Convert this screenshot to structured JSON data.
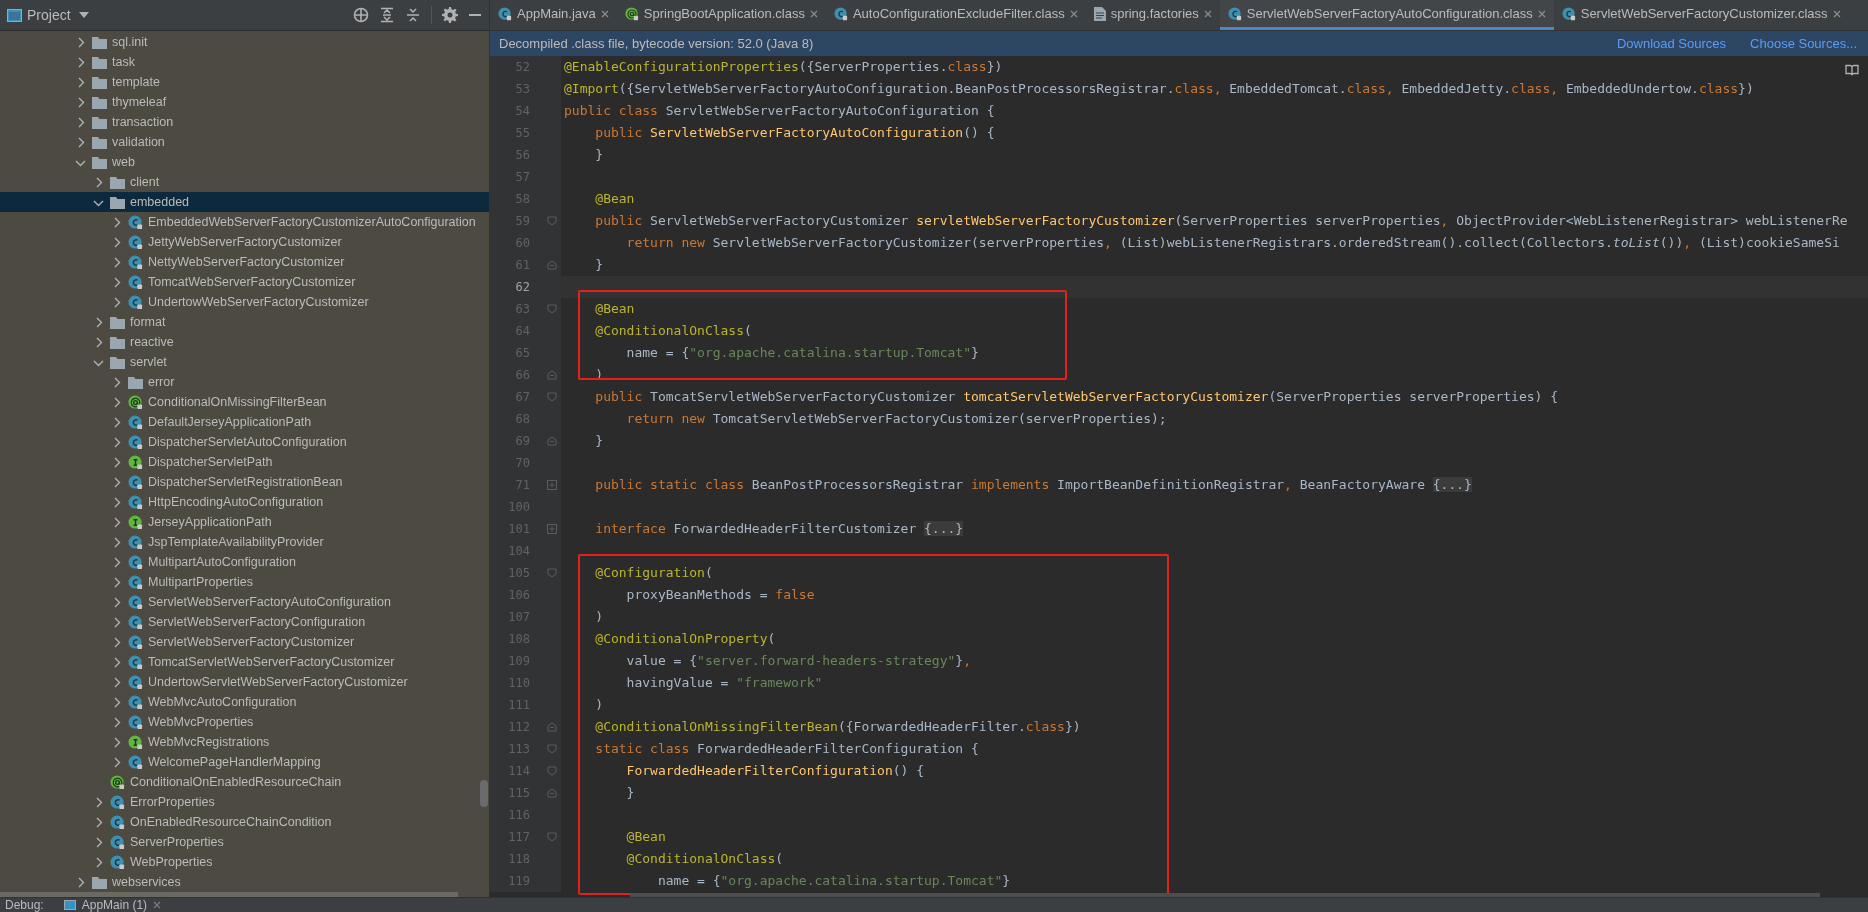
{
  "project_panel": {
    "title": "Project",
    "tree": [
      {
        "label": "sql.init",
        "kind": "folder",
        "expandable": true,
        "expanded": false,
        "selected": false
      },
      {
        "label": "task",
        "kind": "folder",
        "expandable": true,
        "expanded": false,
        "selected": false
      },
      {
        "label": "template",
        "kind": "folder",
        "expandable": true,
        "expanded": false,
        "selected": false
      },
      {
        "label": "thymeleaf",
        "kind": "folder",
        "expandable": true,
        "expanded": false,
        "selected": false
      },
      {
        "label": "transaction",
        "kind": "folder",
        "expandable": true,
        "expanded": false,
        "selected": false
      },
      {
        "label": "validation",
        "kind": "folder",
        "expandable": true,
        "expanded": false,
        "selected": false
      },
      {
        "label": "web",
        "kind": "folder",
        "expandable": true,
        "expanded": true,
        "selected": false,
        "children": [
          {
            "label": "client",
            "kind": "folder",
            "expandable": true,
            "expanded": false,
            "selected": false
          },
          {
            "label": "embedded",
            "kind": "folder",
            "expandable": true,
            "expanded": true,
            "selected": true,
            "children": [
              {
                "label": "EmbeddedWebServerFactoryCustomizerAutoConfiguration",
                "kind": "class",
                "expandable": true,
                "expanded": false,
                "selected": false
              },
              {
                "label": "JettyWebServerFactoryCustomizer",
                "kind": "class",
                "expandable": true,
                "expanded": false,
                "selected": false
              },
              {
                "label": "NettyWebServerFactoryCustomizer",
                "kind": "class",
                "expandable": true,
                "expanded": false,
                "selected": false
              },
              {
                "label": "TomcatWebServerFactoryCustomizer",
                "kind": "class",
                "expandable": true,
                "expanded": false,
                "selected": false
              },
              {
                "label": "UndertowWebServerFactoryCustomizer",
                "kind": "class",
                "expandable": true,
                "expanded": false,
                "selected": false
              }
            ]
          },
          {
            "label": "format",
            "kind": "folder",
            "expandable": true,
            "expanded": false,
            "selected": false
          },
          {
            "label": "reactive",
            "kind": "folder",
            "expandable": true,
            "expanded": false,
            "selected": false
          },
          {
            "label": "servlet",
            "kind": "folder",
            "expandable": true,
            "expanded": true,
            "selected": false,
            "children": [
              {
                "label": "error",
                "kind": "folder",
                "expandable": true,
                "expanded": false,
                "selected": false
              },
              {
                "label": "ConditionalOnMissingFilterBean",
                "kind": "annotation",
                "expandable": true,
                "expanded": false,
                "selected": false
              },
              {
                "label": "DefaultJerseyApplicationPath",
                "kind": "class",
                "expandable": true,
                "expanded": false,
                "selected": false
              },
              {
                "label": "DispatcherServletAutoConfiguration",
                "kind": "class",
                "expandable": true,
                "expanded": false,
                "selected": false
              },
              {
                "label": "DispatcherServletPath",
                "kind": "interface",
                "expandable": true,
                "expanded": false,
                "selected": false
              },
              {
                "label": "DispatcherServletRegistrationBean",
                "kind": "class",
                "expandable": true,
                "expanded": false,
                "selected": false
              },
              {
                "label": "HttpEncodingAutoConfiguration",
                "kind": "class",
                "expandable": true,
                "expanded": false,
                "selected": false
              },
              {
                "label": "JerseyApplicationPath",
                "kind": "interface",
                "expandable": true,
                "expanded": false,
                "selected": false
              },
              {
                "label": "JspTemplateAvailabilityProvider",
                "kind": "class",
                "expandable": true,
                "expanded": false,
                "selected": false
              },
              {
                "label": "MultipartAutoConfiguration",
                "kind": "class",
                "expandable": true,
                "expanded": false,
                "selected": false
              },
              {
                "label": "MultipartProperties",
                "kind": "class",
                "expandable": true,
                "expanded": false,
                "selected": false
              },
              {
                "label": "ServletWebServerFactoryAutoConfiguration",
                "kind": "class",
                "expandable": true,
                "expanded": false,
                "selected": false
              },
              {
                "label": "ServletWebServerFactoryConfiguration",
                "kind": "class",
                "expandable": true,
                "expanded": false,
                "selected": false
              },
              {
                "label": "ServletWebServerFactoryCustomizer",
                "kind": "class",
                "expandable": true,
                "expanded": false,
                "selected": false
              },
              {
                "label": "TomcatServletWebServerFactoryCustomizer",
                "kind": "class",
                "expandable": true,
                "expanded": false,
                "selected": false
              },
              {
                "label": "UndertowServletWebServerFactoryCustomizer",
                "kind": "class",
                "expandable": true,
                "expanded": false,
                "selected": false
              },
              {
                "label": "WebMvcAutoConfiguration",
                "kind": "class",
                "expandable": true,
                "expanded": false,
                "selected": false
              },
              {
                "label": "WebMvcProperties",
                "kind": "class",
                "expandable": true,
                "expanded": false,
                "selected": false
              },
              {
                "label": "WebMvcRegistrations",
                "kind": "interface",
                "expandable": true,
                "expanded": false,
                "selected": false
              },
              {
                "label": "WelcomePageHandlerMapping",
                "kind": "class",
                "expandable": true,
                "expanded": false,
                "selected": false
              }
            ]
          },
          {
            "label": "ConditionalOnEnabledResourceChain",
            "kind": "annotation",
            "expandable": false,
            "selected": false
          },
          {
            "label": "ErrorProperties",
            "kind": "class",
            "expandable": true,
            "expanded": false,
            "selected": false
          },
          {
            "label": "OnEnabledResourceChainCondition",
            "kind": "class",
            "expandable": true,
            "expanded": false,
            "selected": false
          },
          {
            "label": "ServerProperties",
            "kind": "class",
            "expandable": true,
            "expanded": false,
            "selected": false
          },
          {
            "label": "WebProperties",
            "kind": "class",
            "expandable": true,
            "expanded": false,
            "selected": false
          }
        ]
      },
      {
        "label": "webservices",
        "kind": "folder",
        "expandable": true,
        "expanded": false,
        "selected": false
      }
    ]
  },
  "tabs": [
    {
      "label": "AppMain.java",
      "kind": "class",
      "selected": false
    },
    {
      "label": "SpringBootApplication.class",
      "kind": "annotation",
      "selected": false
    },
    {
      "label": "AutoConfigurationExcludeFilter.class",
      "kind": "class",
      "selected": false
    },
    {
      "label": "spring.factories",
      "kind": "file",
      "selected": false
    },
    {
      "label": "ServletWebServerFactoryAutoConfiguration.class",
      "kind": "class",
      "selected": true
    },
    {
      "label": "ServletWebServerFactoryCustomizer.class",
      "kind": "class",
      "selected": false
    }
  ],
  "banner": {
    "message": "Decompiled .class file, bytecode version: 52.0 (Java 8)",
    "links": [
      "Download Sources",
      "Choose Sources..."
    ]
  },
  "code": {
    "blocks": [
      {
        "highlighted": false,
        "lines": [
          {
            "number": "52",
            "current": false,
            "tokens": [
              {
                "kind": "ann",
                "text": "@EnableConfigurationProperties"
              },
              {
                "kind": "plain",
                "text": "({ServerProperties."
              },
              {
                "kind": "kw",
                "text": "class"
              },
              {
                "kind": "plain",
                "text": "})"
              }
            ]
          },
          {
            "number": "53",
            "current": false,
            "tokens": [
              {
                "kind": "ann",
                "text": "@Import"
              },
              {
                "kind": "plain",
                "text": "({ServletWebServerFactoryAutoConfiguration.BeanPostProcessorsRegistrar."
              },
              {
                "kind": "kw",
                "text": "class, "
              },
              {
                "kind": "plain",
                "text": "EmbeddedTomcat."
              },
              {
                "kind": "kw",
                "text": "class, "
              },
              {
                "kind": "plain",
                "text": "EmbeddedJetty."
              },
              {
                "kind": "kw",
                "text": "class, "
              },
              {
                "kind": "plain",
                "text": "EmbeddedUndertow."
              },
              {
                "kind": "kw",
                "text": "class"
              },
              {
                "kind": "plain",
                "text": "})"
              }
            ]
          },
          {
            "number": "54",
            "current": false,
            "tokens": [
              {
                "kind": "kw",
                "text": "public class "
              },
              {
                "kind": "plain",
                "text": "ServletWebServerFactoryAutoConfiguration {"
              }
            ]
          },
          {
            "number": "55",
            "current": false,
            "tokens": [
              {
                "kind": "kw",
                "text": "    public "
              },
              {
                "kind": "fn",
                "text": "ServletWebServerFactoryAutoConfiguration"
              },
              {
                "kind": "plain",
                "text": "() {"
              }
            ]
          },
          {
            "number": "56",
            "current": false,
            "tokens": [
              {
                "kind": "plain",
                "text": "    }"
              }
            ]
          },
          {
            "number": "57",
            "current": false
          },
          {
            "number": "58",
            "current": false,
            "tokens": [
              {
                "kind": "ann",
                "text": "    @Bean"
              }
            ]
          },
          {
            "number": "59",
            "current": false,
            "kind": "fold-start",
            "tokens": [
              {
                "kind": "kw",
                "text": "    public "
              },
              {
                "kind": "plain",
                "text": "ServletWebServerFactoryCustomizer "
              },
              {
                "kind": "fn",
                "text": "servletWebServerFactoryCustomizer"
              },
              {
                "kind": "plain",
                "text": "(ServerProperties serverProperties"
              },
              {
                "kind": "kw",
                "text": ", "
              },
              {
                "kind": "plain",
                "text": "ObjectProvider<WebListenerRegistrar> webListenerRe"
              }
            ]
          },
          {
            "number": "60",
            "current": false,
            "tokens": [
              {
                "kind": "kw",
                "text": "        return new "
              },
              {
                "kind": "plain",
                "text": "ServletWebServerFactoryCustomizer(serverProperties"
              },
              {
                "kind": "kw",
                "text": ", "
              },
              {
                "kind": "plain",
                "text": "(List)webListenerRegistrars.orderedStream().collect(Collectors."
              },
              {
                "kind": "static",
                "text": "toList"
              },
              {
                "kind": "plain",
                "text": "())"
              },
              {
                "kind": "kw",
                "text": ", "
              },
              {
                "kind": "plain",
                "text": "(List)cookieSameSi"
              }
            ]
          },
          {
            "number": "61",
            "current": false,
            "kind": "fold-end",
            "tokens": [
              {
                "kind": "plain",
                "text": "    }"
              }
            ]
          },
          {
            "number": "62",
            "current": true
          }
        ]
      },
      {
        "highlighted": true,
        "lines": [
          {
            "number": "63",
            "current": false,
            "kind": "fold-start",
            "tokens": [
              {
                "kind": "ann",
                "text": "    @Bean"
              }
            ]
          },
          {
            "number": "64",
            "current": false,
            "tokens": [
              {
                "kind": "ann",
                "text": "    @ConditionalOnClass"
              },
              {
                "kind": "plain",
                "text": "("
              }
            ]
          },
          {
            "number": "65",
            "current": false,
            "tokens": [
              {
                "kind": "plain",
                "text": "        name = {"
              },
              {
                "kind": "str",
                "text": "\"org.apache.catalina.startup.Tomcat\""
              },
              {
                "kind": "plain",
                "text": "}"
              }
            ]
          },
          {
            "number": "66",
            "current": false,
            "kind": "fold-end",
            "tokens": [
              {
                "kind": "plain",
                "text": "    )"
              }
            ]
          }
        ]
      },
      {
        "highlighted": false,
        "lines": [
          {
            "number": "67",
            "current": false,
            "kind": "fold-start",
            "tokens": [
              {
                "kind": "kw",
                "text": "    public "
              },
              {
                "kind": "plain",
                "text": "TomcatServletWebServerFactoryCustomizer "
              },
              {
                "kind": "fn",
                "text": "tomcatServletWebServerFactoryCustomizer"
              },
              {
                "kind": "plain",
                "text": "(ServerProperties serverProperties) {"
              }
            ]
          },
          {
            "number": "68",
            "current": false,
            "tokens": [
              {
                "kind": "kw",
                "text": "        return new "
              },
              {
                "kind": "plain",
                "text": "TomcatServletWebServerFactoryCustomizer(serverProperties);"
              }
            ]
          },
          {
            "number": "69",
            "current": false,
            "kind": "fold-end",
            "tokens": [
              {
                "kind": "plain",
                "text": "    }"
              }
            ]
          },
          {
            "number": "70",
            "current": false
          },
          {
            "number": "71",
            "current": false,
            "kind": "collapsed-fold",
            "tokens": [
              {
                "kind": "kw",
                "text": "    public static class "
              },
              {
                "kind": "plain",
                "text": "BeanPostProcessorsRegistrar "
              },
              {
                "kind": "kw",
                "text": "implements "
              },
              {
                "kind": "plain",
                "text": "ImportBeanDefinitionRegistrar"
              },
              {
                "kind": "kw",
                "text": ", "
              },
              {
                "kind": "plain",
                "text": "BeanFactoryAware "
              },
              {
                "kind": "folded",
                "text": "{...}"
              }
            ]
          },
          {
            "number": "100",
            "current": false
          },
          {
            "number": "101",
            "current": false,
            "kind": "collapsed-fold",
            "tokens": [
              {
                "kind": "kw",
                "text": "    interface "
              },
              {
                "kind": "plain",
                "text": "ForwardedHeaderFilterCustomizer "
              },
              {
                "kind": "folded",
                "text": "{...}"
              }
            ]
          },
          {
            "number": "104",
            "current": false
          }
        ]
      },
      {
        "highlighted": true,
        "lines": [
          {
            "number": "105",
            "current": false,
            "kind": "fold-start",
            "tokens": [
              {
                "kind": "ann",
                "text": "    @Configuration"
              },
              {
                "kind": "plain",
                "text": "("
              }
            ]
          },
          {
            "number": "106",
            "current": false,
            "tokens": [
              {
                "kind": "plain",
                "text": "        proxyBeanMethods = "
              },
              {
                "kind": "kw",
                "text": "false"
              }
            ]
          },
          {
            "number": "107",
            "current": false,
            "tokens": [
              {
                "kind": "plain",
                "text": "    )"
              }
            ]
          },
          {
            "number": "108",
            "current": false,
            "tokens": [
              {
                "kind": "ann",
                "text": "    @ConditionalOnProperty"
              },
              {
                "kind": "plain",
                "text": "("
              }
            ]
          },
          {
            "number": "109",
            "current": false,
            "tokens": [
              {
                "kind": "plain",
                "text": "        value = {"
              },
              {
                "kind": "str",
                "text": "\"server.forward-headers-strategy\""
              },
              {
                "kind": "plain",
                "text": "}"
              },
              {
                "kind": "kw",
                "text": ","
              }
            ]
          },
          {
            "number": "110",
            "current": false,
            "tokens": [
              {
                "kind": "plain",
                "text": "        havingValue = "
              },
              {
                "kind": "str",
                "text": "\"framework\""
              }
            ]
          },
          {
            "number": "111",
            "current": false,
            "tokens": [
              {
                "kind": "plain",
                "text": "    )"
              }
            ]
          },
          {
            "number": "112",
            "current": false,
            "kind": "fold-end",
            "tokens": [
              {
                "kind": "ann",
                "text": "    @ConditionalOnMissingFilterBean"
              },
              {
                "kind": "plain",
                "text": "({ForwardedHeaderFilter."
              },
              {
                "kind": "kw",
                "text": "class"
              },
              {
                "kind": "plain",
                "text": "})"
              }
            ]
          },
          {
            "number": "113",
            "current": false,
            "kind": "fold-start",
            "tokens": [
              {
                "kind": "kw",
                "text": "    static class "
              },
              {
                "kind": "plain",
                "text": "ForwardedHeaderFilterConfiguration {"
              }
            ]
          },
          {
            "number": "114",
            "current": false,
            "kind": "fold-start",
            "tokens": [
              {
                "kind": "fn",
                "text": "        ForwardedHeaderFilterConfiguration"
              },
              {
                "kind": "plain",
                "text": "() {"
              }
            ]
          },
          {
            "number": "115",
            "current": false,
            "kind": "fold-end",
            "tokens": [
              {
                "kind": "plain",
                "text": "        }"
              }
            ]
          },
          {
            "number": "116",
            "current": false
          },
          {
            "number": "117",
            "current": false,
            "kind": "fold-start",
            "tokens": [
              {
                "kind": "ann",
                "text": "        @Bean"
              }
            ]
          },
          {
            "number": "118",
            "current": false,
            "tokens": [
              {
                "kind": "ann",
                "text": "        @ConditionalOnClass"
              },
              {
                "kind": "plain",
                "text": "("
              }
            ]
          },
          {
            "number": "119",
            "current": false,
            "tokens": [
              {
                "kind": "plain",
                "text": "            name = {"
              },
              {
                "kind": "str",
                "text": "\"org.apache.catalina.startup.Tomcat\""
              },
              {
                "kind": "plain",
                "text": "}"
              }
            ]
          }
        ]
      }
    ]
  },
  "debug_bar": {
    "label": "Debug:",
    "session": "AppMain (1)"
  }
}
